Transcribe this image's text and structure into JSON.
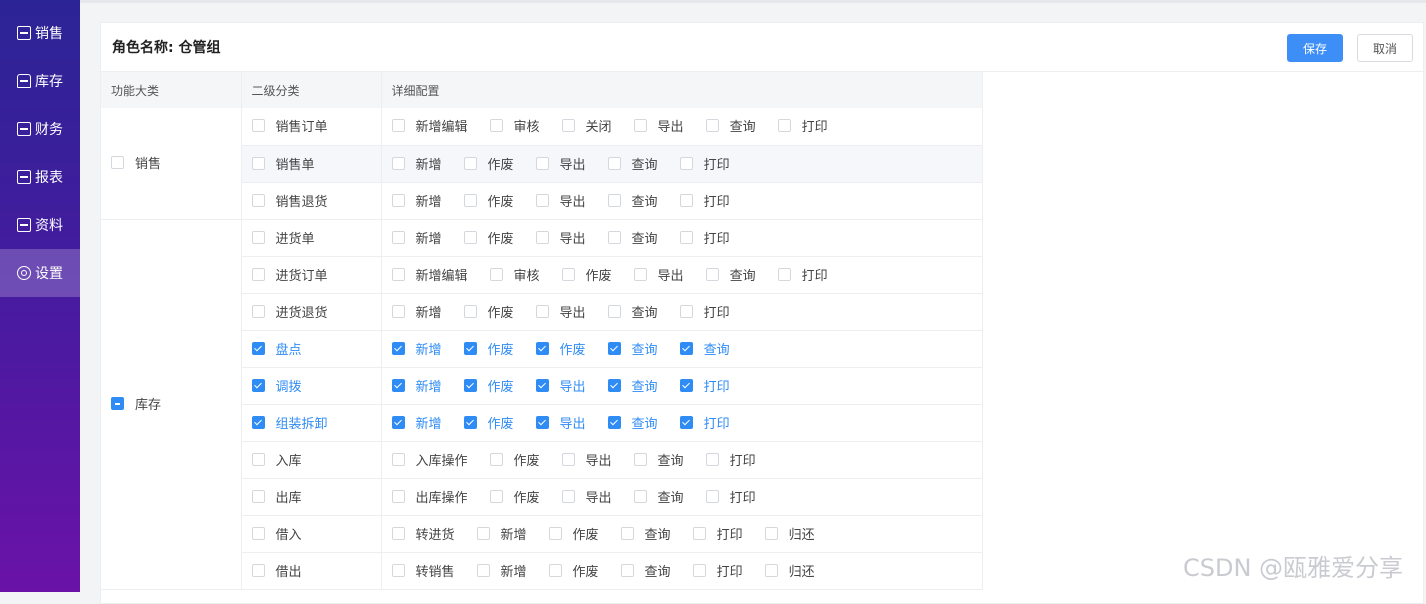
{
  "sidebar": {
    "items": [
      {
        "label": "销售",
        "icon": "sales-icon",
        "active": false
      },
      {
        "label": "库存",
        "icon": "home-icon",
        "active": false
      },
      {
        "label": "财务",
        "icon": "finance-icon",
        "active": false
      },
      {
        "label": "报表",
        "icon": "report-icon",
        "active": false
      },
      {
        "label": "资料",
        "icon": "data-icon",
        "active": false
      },
      {
        "label": "设置",
        "icon": "settings-icon",
        "active": true
      }
    ]
  },
  "header": {
    "role_label": "角色名称: 仓管组",
    "save_label": "保存",
    "cancel_label": "取消"
  },
  "table": {
    "columns": [
      "功能大类",
      "二级分类",
      "详细配置"
    ],
    "groups": [
      {
        "label": "销售",
        "state": "unchecked",
        "rows": [
          {
            "label": "销售订单",
            "checked": false,
            "highlight": false,
            "actions": [
              {
                "label": "新增编辑",
                "checked": false
              },
              {
                "label": "审核",
                "checked": false
              },
              {
                "label": "关闭",
                "checked": false
              },
              {
                "label": "导出",
                "checked": false
              },
              {
                "label": "查询",
                "checked": false
              },
              {
                "label": "打印",
                "checked": false
              }
            ]
          },
          {
            "label": "销售单",
            "checked": false,
            "highlight": true,
            "actions": [
              {
                "label": "新增",
                "checked": false
              },
              {
                "label": "作废",
                "checked": false
              },
              {
                "label": "导出",
                "checked": false
              },
              {
                "label": "查询",
                "checked": false
              },
              {
                "label": "打印",
                "checked": false
              }
            ]
          },
          {
            "label": "销售退货",
            "checked": false,
            "highlight": false,
            "actions": [
              {
                "label": "新增",
                "checked": false
              },
              {
                "label": "作废",
                "checked": false
              },
              {
                "label": "导出",
                "checked": false
              },
              {
                "label": "查询",
                "checked": false
              },
              {
                "label": "打印",
                "checked": false
              }
            ]
          }
        ]
      },
      {
        "label": "库存",
        "state": "indeterminate",
        "rows": [
          {
            "label": "进货单",
            "checked": false,
            "highlight": false,
            "actions": [
              {
                "label": "新增",
                "checked": false
              },
              {
                "label": "作废",
                "checked": false
              },
              {
                "label": "导出",
                "checked": false
              },
              {
                "label": "查询",
                "checked": false
              },
              {
                "label": "打印",
                "checked": false
              }
            ]
          },
          {
            "label": "进货订单",
            "checked": false,
            "highlight": false,
            "actions": [
              {
                "label": "新增编辑",
                "checked": false
              },
              {
                "label": "审核",
                "checked": false
              },
              {
                "label": "作废",
                "checked": false
              },
              {
                "label": "导出",
                "checked": false
              },
              {
                "label": "查询",
                "checked": false
              },
              {
                "label": "打印",
                "checked": false
              }
            ]
          },
          {
            "label": "进货退货",
            "checked": false,
            "highlight": false,
            "actions": [
              {
                "label": "新增",
                "checked": false
              },
              {
                "label": "作废",
                "checked": false
              },
              {
                "label": "导出",
                "checked": false
              },
              {
                "label": "查询",
                "checked": false
              },
              {
                "label": "打印",
                "checked": false
              }
            ]
          },
          {
            "label": "盘点",
            "checked": true,
            "highlight": false,
            "actions": [
              {
                "label": "新增",
                "checked": true
              },
              {
                "label": "作废",
                "checked": true
              },
              {
                "label": "作废",
                "checked": true
              },
              {
                "label": "查询",
                "checked": true
              },
              {
                "label": "查询",
                "checked": true
              }
            ]
          },
          {
            "label": "调拨",
            "checked": true,
            "highlight": false,
            "actions": [
              {
                "label": "新增",
                "checked": true
              },
              {
                "label": "作废",
                "checked": true
              },
              {
                "label": "导出",
                "checked": true
              },
              {
                "label": "查询",
                "checked": true
              },
              {
                "label": "打印",
                "checked": true
              }
            ]
          },
          {
            "label": "组装拆卸",
            "checked": true,
            "highlight": false,
            "actions": [
              {
                "label": "新增",
                "checked": true
              },
              {
                "label": "作废",
                "checked": true
              },
              {
                "label": "导出",
                "checked": true
              },
              {
                "label": "查询",
                "checked": true
              },
              {
                "label": "打印",
                "checked": true
              }
            ]
          },
          {
            "label": "入库",
            "checked": false,
            "highlight": false,
            "actions": [
              {
                "label": "入库操作",
                "checked": false
              },
              {
                "label": "作废",
                "checked": false
              },
              {
                "label": "导出",
                "checked": false
              },
              {
                "label": "查询",
                "checked": false
              },
              {
                "label": "打印",
                "checked": false
              }
            ]
          },
          {
            "label": "出库",
            "checked": false,
            "highlight": false,
            "actions": [
              {
                "label": "出库操作",
                "checked": false
              },
              {
                "label": "作废",
                "checked": false
              },
              {
                "label": "导出",
                "checked": false
              },
              {
                "label": "查询",
                "checked": false
              },
              {
                "label": "打印",
                "checked": false
              }
            ]
          },
          {
            "label": "借入",
            "checked": false,
            "highlight": false,
            "actions": [
              {
                "label": "转进货",
                "checked": false
              },
              {
                "label": "新增",
                "checked": false
              },
              {
                "label": "作废",
                "checked": false
              },
              {
                "label": "查询",
                "checked": false
              },
              {
                "label": "打印",
                "checked": false
              },
              {
                "label": "归还",
                "checked": false
              }
            ]
          },
          {
            "label": "借出",
            "checked": false,
            "highlight": false,
            "actions": [
              {
                "label": "转销售",
                "checked": false
              },
              {
                "label": "新增",
                "checked": false
              },
              {
                "label": "作废",
                "checked": false
              },
              {
                "label": "查询",
                "checked": false
              },
              {
                "label": "打印",
                "checked": false
              },
              {
                "label": "归还",
                "checked": false
              }
            ]
          }
        ]
      }
    ]
  },
  "watermark": "CSDN @瓯雅爱分享",
  "colors": {
    "accent": "#2f8cf5",
    "sidebar_top": "#2b2496",
    "sidebar_bottom": "#6a12a8"
  }
}
